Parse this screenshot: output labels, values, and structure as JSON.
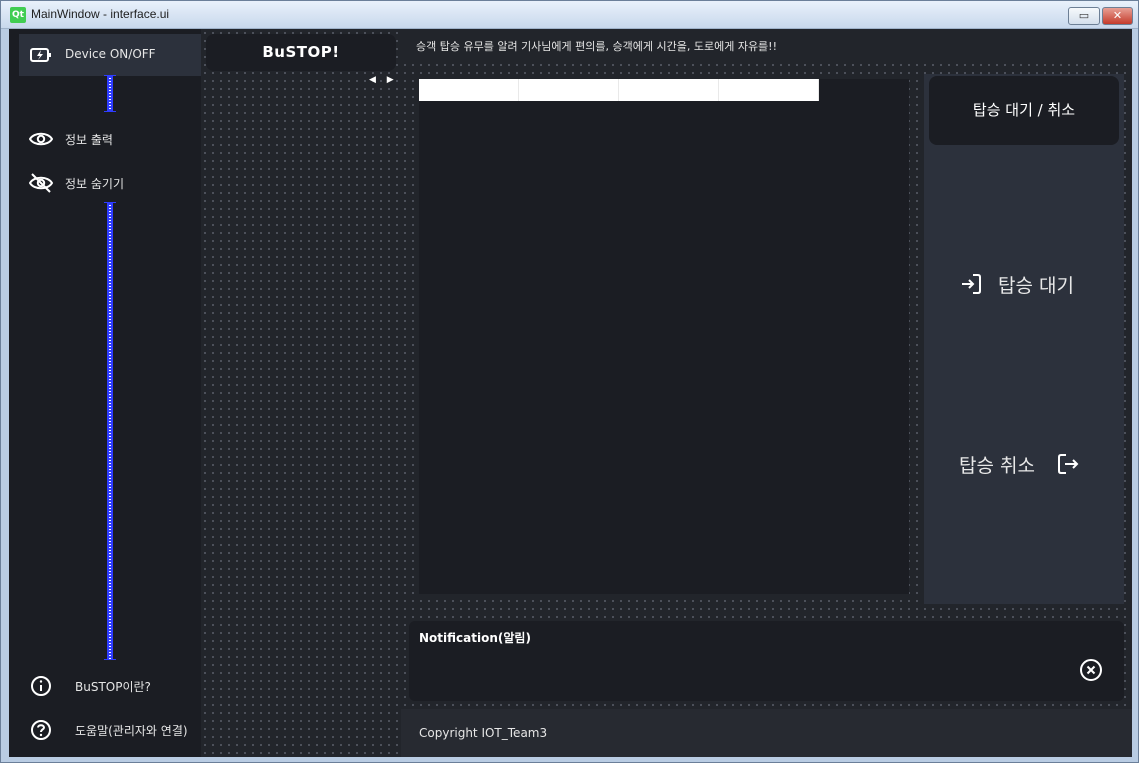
{
  "window": {
    "title": "MainWindow - interface.ui",
    "app_icon": "Qt",
    "minimize_glyph": "▭",
    "close_glyph": "✕"
  },
  "left_menu": {
    "device_toggle": "Device ON/OFF",
    "show_info": "정보 출력",
    "hide_info": "정보 숨기기",
    "about": "BuSTOP이란?",
    "help": "도움말(관리자와 연결)"
  },
  "extra": {
    "title": "BuSTOP!",
    "splitter_arrows": "◀ ▶"
  },
  "header": {
    "slogan": "승객 탑승 유무를 알려 기사님에게 편의를, 승객에게 시간을, 도로에게 자유를!!"
  },
  "table": {
    "columns": [
      "",
      "",
      "",
      ""
    ]
  },
  "side_panel": {
    "title": "탑승 대기 / 취소",
    "wait_button": "탑승 대기",
    "cancel_button": "탑승 취소"
  },
  "notification": {
    "title": "Notification(알림)"
  },
  "footer": {
    "copyright": "Copyright IOT_Team3"
  },
  "colors": {
    "bg_dark": "#1b1d23",
    "bg_panel": "#2c313c",
    "bg_mid": "#22252b",
    "spacer": "#2f3dff",
    "qt_green": "#41cd52"
  }
}
